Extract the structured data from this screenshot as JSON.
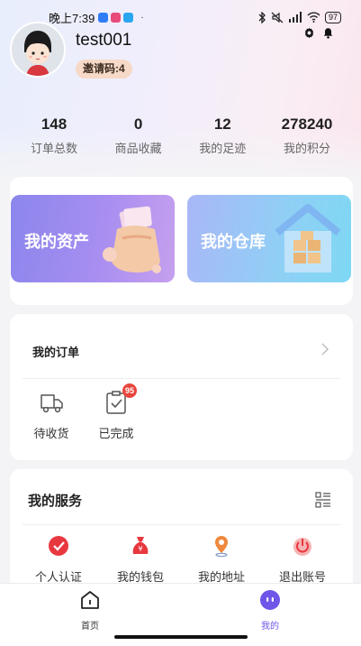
{
  "status_bar": {
    "time": "晚上7:39",
    "dot": "·",
    "battery": "97",
    "app_icon_colors": [
      "#2f7cf6",
      "#e84b7a",
      "#2aa6f0"
    ]
  },
  "profile": {
    "username": "test001",
    "invite_code": "邀请码:4"
  },
  "stats": [
    {
      "value": "148",
      "label": "订单总数"
    },
    {
      "value": "0",
      "label": "商品收藏"
    },
    {
      "value": "12",
      "label": "我的足迹"
    },
    {
      "value": "278240",
      "label": "我的积分"
    }
  ],
  "tiles": {
    "assets": "我的资产",
    "warehouse": "我的仓库"
  },
  "orders": {
    "title": "我的订单",
    "items": [
      {
        "label": "待收货",
        "icon": "truck-icon"
      },
      {
        "label": "已完成",
        "icon": "clipboard-check-icon",
        "badge": "95"
      }
    ]
  },
  "services": {
    "title": "我的服务",
    "items": [
      {
        "label": "个人认证",
        "icon": "verify-icon"
      },
      {
        "label": "我的钱包",
        "icon": "wallet-icon"
      },
      {
        "label": "我的地址",
        "icon": "location-icon"
      },
      {
        "label": "退出账号",
        "icon": "power-icon"
      }
    ]
  },
  "nav": {
    "home": "首页",
    "mine": "我的"
  },
  "colors": {
    "accent": "#6f55e8",
    "badge": "#e8453c",
    "service_red": "#e8383f"
  }
}
